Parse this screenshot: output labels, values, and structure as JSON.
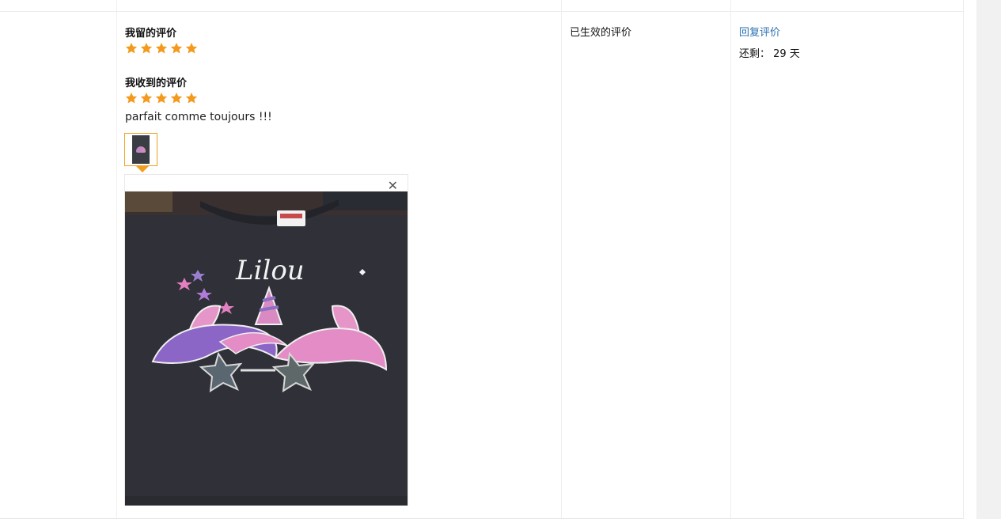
{
  "review": {
    "my_review_heading": "我留的评价",
    "my_rating": 5,
    "received_review_heading": "我收到的评价",
    "received_rating": 5,
    "comment": "parfait comme toujours !!!",
    "star_color": "#f39a1e"
  },
  "status_column": {
    "status_text": "已生效的评价"
  },
  "action_column": {
    "reply_label": "回复评价",
    "remaining_label": "还剩：",
    "remaining_days": "29 天",
    "link_color": "#2a6fb0"
  },
  "photo_viewer": {
    "close_symbol": "✕",
    "shirt_print_text": "Lilou"
  }
}
